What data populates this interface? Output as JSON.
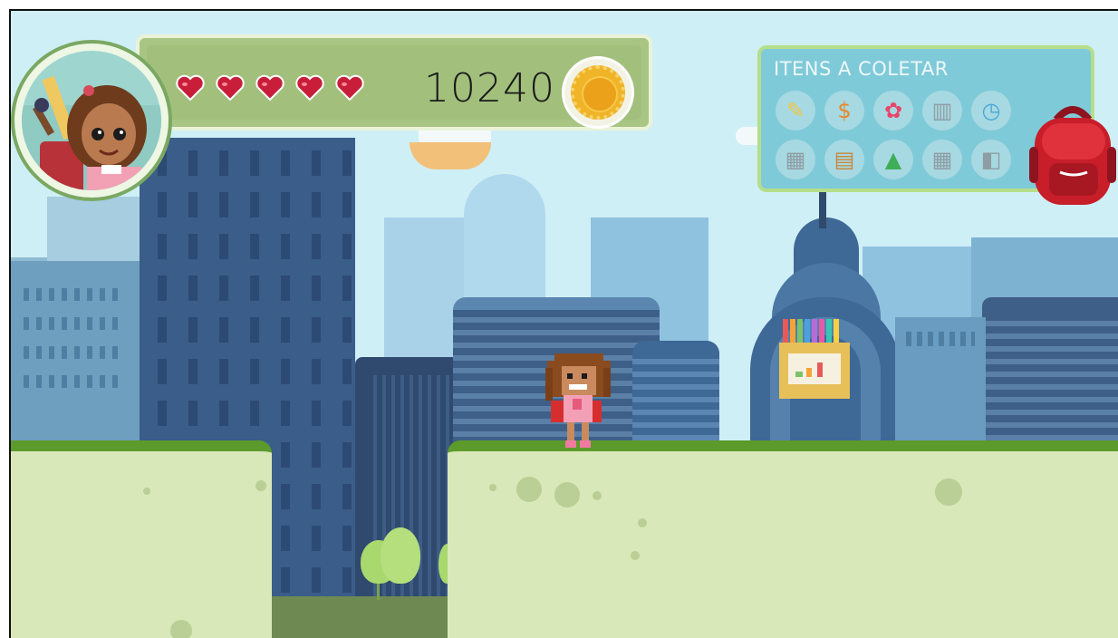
{
  "hud": {
    "lives": {
      "count": 5,
      "max": 5
    },
    "score": "10240",
    "items_panel_title": "ITENS A COLETAR",
    "items": [
      {
        "icon": "pencil-icon",
        "collected": true
      },
      {
        "icon": "money-bag-icon",
        "collected": true
      },
      {
        "icon": "flower-icon",
        "collected": true
      },
      {
        "icon": "books-icon",
        "collected": false
      },
      {
        "icon": "clock-icon",
        "collected": true
      },
      {
        "icon": "cash-register-icon",
        "collected": false
      },
      {
        "icon": "clipboard-icon",
        "collected": true
      },
      {
        "icon": "shapes-icon",
        "collected": true
      },
      {
        "icon": "calculator-icon",
        "collected": false
      },
      {
        "icon": "backpack-small-icon",
        "collected": false
      }
    ]
  },
  "colors": {
    "sky": "#cfeff6",
    "grass": "#5d9a2c",
    "ground": "#d9e8b9",
    "heart": "#c81e3a",
    "coin": "#f0b428",
    "backpack": "#c81e2a"
  }
}
